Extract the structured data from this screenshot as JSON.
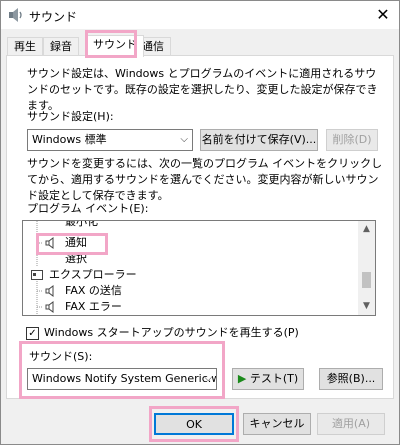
{
  "window": {
    "title": "サウンド"
  },
  "tabs": [
    {
      "label": "再生"
    },
    {
      "label": "録音"
    },
    {
      "label": "サウンド"
    },
    {
      "label": "通信"
    }
  ],
  "sound_panel": {
    "description": "サウンド設定は、Windows とプログラムのイベントに適用されるサウンドのセットです。既存の設定を選択したり、変更した設定が保存できます。",
    "scheme_label": "サウンド設定(H):",
    "scheme_value": "Windows 標準",
    "save_as_label": "名前を付けて保存(V)...",
    "delete_label": "削除(D)",
    "change_instruction": "サウンドを変更するには、次の一覧のプログラム イベントをクリックしてから、適用するサウンドを選んでください。変更内容が新しいサウンド設定として保存できます。",
    "events_label": "プログラム イベント(E):",
    "events": [
      {
        "label": "最小化"
      },
      {
        "label": "通知"
      },
      {
        "label": "選択"
      },
      {
        "label": "エクスプローラー"
      },
      {
        "label": "FAX の送信"
      },
      {
        "label": "FAX エラー"
      }
    ],
    "startup_checkbox_label": "Windows スタートアップのサウンドを再生する(P)",
    "startup_checked": true,
    "sound_label": "サウンド(S):",
    "sound_value": "Windows Notify System Generic.wav",
    "test_label": "テスト(T)",
    "browse_label": "参照(B)..."
  },
  "footer": {
    "ok_label": "OK",
    "cancel_label": "キャンセル",
    "apply_label": "適用(A)"
  },
  "colors": {
    "highlight": "#f2a6c7",
    "accent": "#0078d7",
    "test_icon": "#1b8a1b"
  }
}
